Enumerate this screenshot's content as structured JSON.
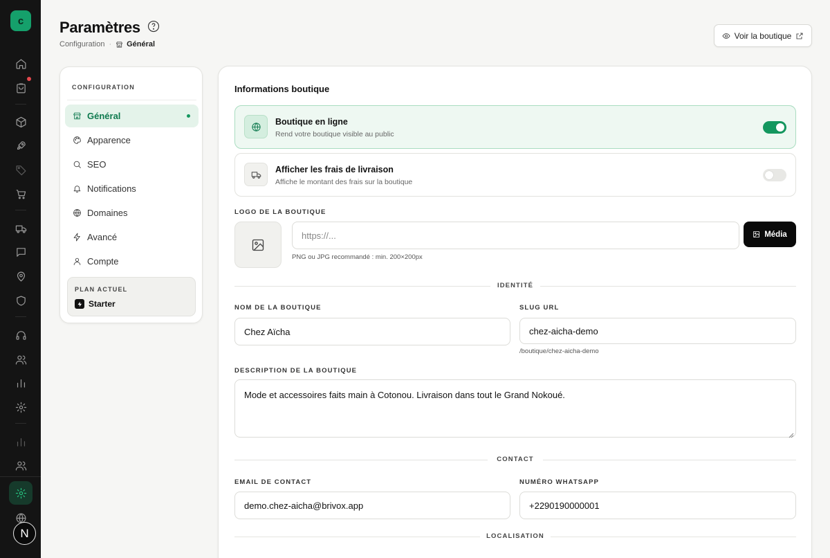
{
  "app": {
    "logo_letter": "c",
    "avatar_letter": "N"
  },
  "header": {
    "title": "Paramètres",
    "breadcrumb_root": "Configuration",
    "breadcrumb_current": "Général",
    "view_store_label": "Voir la boutique"
  },
  "settings_nav": {
    "heading": "CONFIGURATION",
    "items": [
      {
        "label": "Général",
        "icon": "store-icon",
        "active": true
      },
      {
        "label": "Apparence",
        "icon": "palette-icon"
      },
      {
        "label": "SEO",
        "icon": "search-icon"
      },
      {
        "label": "Notifications",
        "icon": "bell-icon"
      },
      {
        "label": "Domaines",
        "icon": "globe-icon"
      },
      {
        "label": "Avancé",
        "icon": "bolt-icon"
      },
      {
        "label": "Compte",
        "icon": "user-icon"
      }
    ],
    "plan_label": "PLAN ACTUEL",
    "plan_name": "Starter"
  },
  "main": {
    "section_title": "Informations boutique",
    "online_toggle": {
      "title": "Boutique en ligne",
      "subtitle": "Rend votre boutique visible au public",
      "on": true
    },
    "shipping_toggle": {
      "title": "Afficher les frais de livraison",
      "subtitle": "Affiche le montant des frais sur la boutique",
      "on": false
    },
    "logo": {
      "label": "LOGO DE LA BOUTIQUE",
      "placeholder": "https://...",
      "media_label": "Média",
      "hint": "PNG ou JPG recommandé : min. 200×200px"
    },
    "identity_divider": "IDENTITÉ",
    "store_name": {
      "label": "NOM DE LA BOUTIQUE",
      "value": "Chez Aïcha"
    },
    "slug": {
      "label": "SLUG URL",
      "value": "chez-aicha-demo",
      "hint": "/boutique/chez-aicha-demo"
    },
    "description": {
      "label": "DESCRIPTION DE LA BOUTIQUE",
      "value": "Mode et accessoires faits main à Cotonou. Livraison dans tout le Grand Nokoué."
    },
    "contact_divider": "CONTACT",
    "email": {
      "label": "EMAIL DE CONTACT",
      "value": "demo.chez-aicha@brivox.app"
    },
    "whatsapp": {
      "label": "NUMÉRO WHATSAPP",
      "value": "+2290190000001"
    },
    "location_divider": "LOCALISATION"
  },
  "colors": {
    "accent": "#14975f",
    "accent_bg": "#e4f3ea",
    "rail_bg": "#141414",
    "notification_dot": "#e5484d"
  }
}
